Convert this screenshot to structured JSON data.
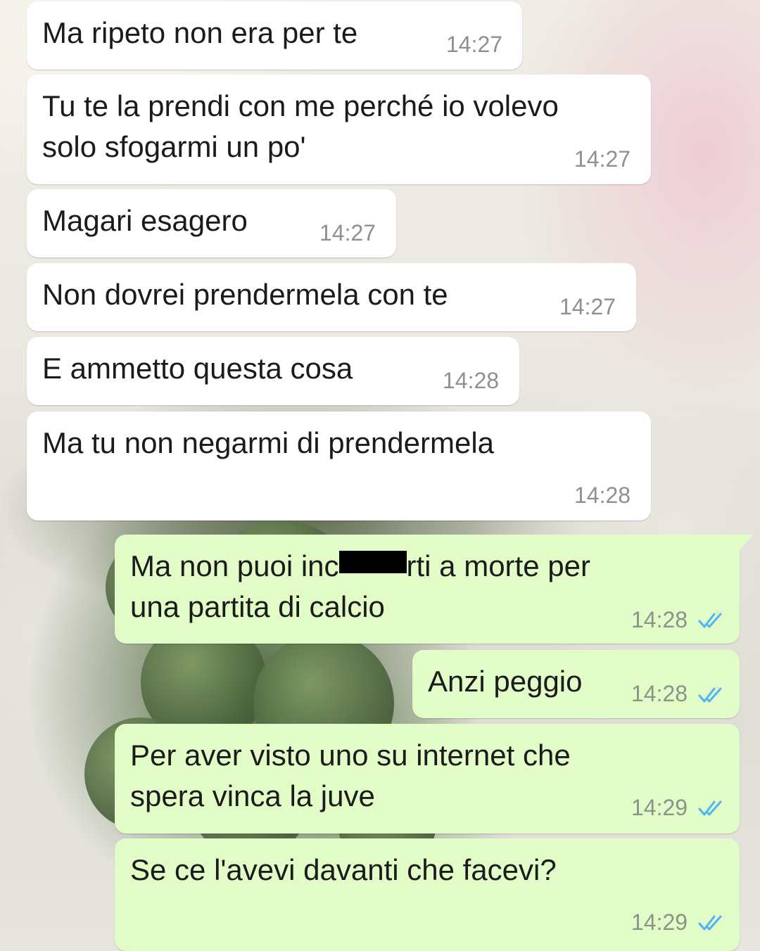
{
  "chat": {
    "messages": [
      {
        "direction": "incoming",
        "text": "Ma ripeto non era per te",
        "time": "14:27"
      },
      {
        "direction": "incoming",
        "text": "Tu te la prendi con me perché io volevo\nsolo sfogarmi un po'",
        "time": "14:27"
      },
      {
        "direction": "incoming",
        "text": "Magari esagero",
        "time": "14:27"
      },
      {
        "direction": "incoming",
        "text": "Non dovrei prendermela con te",
        "time": "14:27"
      },
      {
        "direction": "incoming",
        "text": "E ammetto questa cosa",
        "time": "14:28"
      },
      {
        "direction": "incoming",
        "text": "Ma tu non negarmi di prendermela",
        "time": "14:28"
      },
      {
        "direction": "outgoing",
        "text_before_redaction": "Ma non puoi inc",
        "text_after_redaction": "rti a morte per\nuna partita di calcio",
        "time": "14:28",
        "status_icon": "double-check-read-icon"
      },
      {
        "direction": "outgoing",
        "text": "Anzi peggio",
        "time": "14:28",
        "status_icon": "double-check-read-icon"
      },
      {
        "direction": "outgoing",
        "text": "Per aver visto uno su internet che\nspera vinca la juve",
        "time": "14:29",
        "status_icon": "double-check-read-icon"
      },
      {
        "direction": "outgoing",
        "text": "Se ce l'avevi davanti che facevi?",
        "time": "14:29",
        "status_icon": "double-check-read-icon"
      }
    ]
  },
  "colors": {
    "incoming_bubble": "#ffffff",
    "outgoing_bubble": "#e1fcc7",
    "read_check": "#4fb3f6",
    "timestamp": "#8b938b",
    "message_text": "#1b1b1b"
  }
}
